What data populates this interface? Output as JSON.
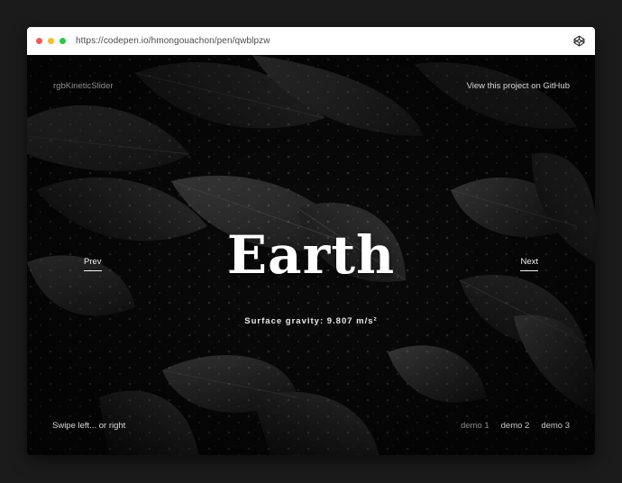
{
  "browser": {
    "url": "https://codepen.io/hmongouachon/pen/qwblpzw",
    "icon": "codepen-icon"
  },
  "header": {
    "brand": "rgbKineticSlider",
    "github_link": "View this project on GitHub"
  },
  "slide": {
    "title": "Earth",
    "subtitle": "Surface gravity: 9.807 m/s²"
  },
  "nav": {
    "prev": "Prev",
    "next": "Next"
  },
  "footer": {
    "hint": "Swipe left... or right",
    "demos": [
      "demo 1",
      "demo 2",
      "demo 3"
    ]
  },
  "colors": {
    "traffic_red": "#f25b55",
    "traffic_yellow": "#f6be2f",
    "traffic_green": "#2bc74a",
    "page_bg": "#1b1b1b"
  }
}
